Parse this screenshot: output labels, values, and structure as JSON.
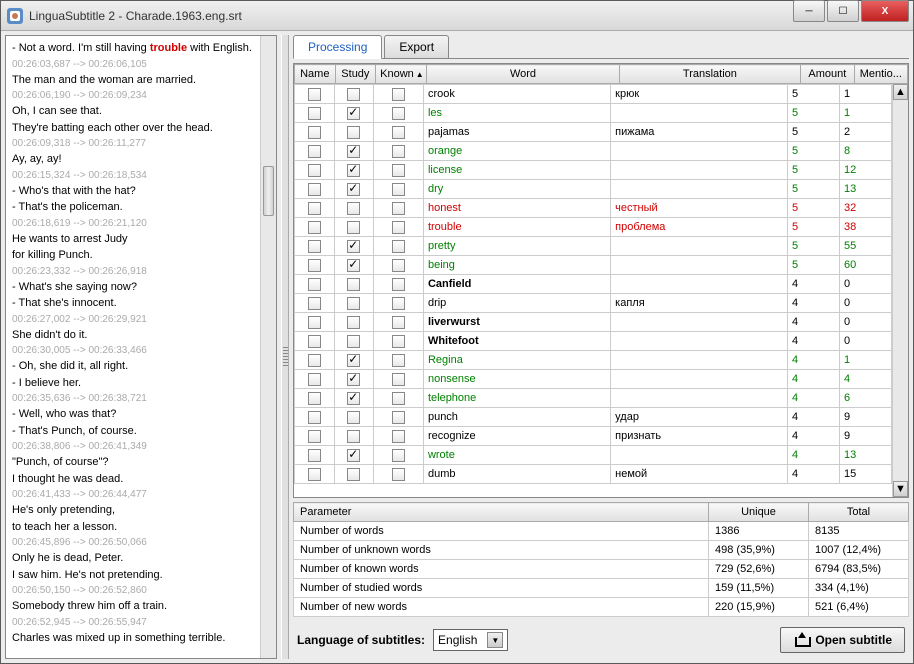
{
  "window": {
    "title": "LinguaSubtitle 2 - Charade.1963.eng.srt"
  },
  "subtitles": [
    {
      "text": "- Not a word. I'm still having ",
      "hl": "trouble",
      "tail": " with English.",
      "time": "00:26:03,687 --> 00:26:06,105"
    },
    {
      "text": "The man and the woman are married.",
      "time": "00:26:06,190 --> 00:26:09,234"
    },
    {
      "text": "Oh, I can see that.\nThey're batting each other over the head.",
      "time": "00:26:09,318 --> 00:26:11,277"
    },
    {
      "text": "Ay, ay, ay!",
      "time": "00:26:15,324 --> 00:26:18,534"
    },
    {
      "text": "- Who's that with the hat?\n- That's the policeman.",
      "time": "00:26:18,619 --> 00:26:21,120"
    },
    {
      "text": "He wants to arrest Judy\nfor killing Punch.",
      "time": "00:26:23,332 --> 00:26:26,918"
    },
    {
      "text": "- What's she saying now?\n- That she's innocent.",
      "time": "00:26:27,002 --> 00:26:29,921"
    },
    {
      "text": "She didn't do it.",
      "time": "00:26:30,005 --> 00:26:33,466"
    },
    {
      "text": "- Oh, she did it, all right.\n- I believe her.",
      "time": "00:26:35,636 --> 00:26:38,721"
    },
    {
      "text": "- Well, who was that?\n- That's Punch, of course.",
      "time": "00:26:38,806 --> 00:26:41,349"
    },
    {
      "text": "\"Punch, of course\"?\nI thought he was dead.",
      "time": "00:26:41,433 --> 00:26:44,477"
    },
    {
      "text": "He's only pretending,\nto teach her a lesson.",
      "time": "00:26:45,896 --> 00:26:50,066"
    },
    {
      "text": "Only he is dead, Peter.\nI saw him. He's not pretending.",
      "time": "00:26:50,150 --> 00:26:52,860"
    },
    {
      "text": "Somebody threw him off a train.",
      "time": "00:26:52,945 --> 00:26:55,947"
    },
    {
      "text": "Charles was mixed up in something terrible.",
      "time": ""
    }
  ],
  "tabs": {
    "processing": "Processing",
    "export": "Export"
  },
  "columns": {
    "name": "Name",
    "study": "Study",
    "known": "Known",
    "word": "Word",
    "translation": "Translation",
    "amount": "Amount",
    "mention": "Mentio..."
  },
  "rows": [
    {
      "study": false,
      "word": "crook",
      "cls": "",
      "trans": "крюк",
      "amount": "5",
      "mention": "1"
    },
    {
      "study": true,
      "word": "les",
      "cls": "g",
      "trans": "",
      "amount": "5",
      "mention": "1",
      "ncls": "g"
    },
    {
      "study": false,
      "word": "pajamas",
      "cls": "",
      "trans": "пижама",
      "amount": "5",
      "mention": "2"
    },
    {
      "study": true,
      "word": "orange",
      "cls": "g",
      "trans": "",
      "amount": "5",
      "mention": "8",
      "ncls": "g"
    },
    {
      "study": true,
      "word": "license",
      "cls": "g",
      "trans": "",
      "amount": "5",
      "mention": "12",
      "ncls": "g"
    },
    {
      "study": true,
      "word": "dry",
      "cls": "g",
      "trans": "",
      "amount": "5",
      "mention": "13",
      "ncls": "g"
    },
    {
      "study": false,
      "word": "honest",
      "cls": "r",
      "trans": "честный",
      "amount": "5",
      "mention": "32",
      "ncls": "r"
    },
    {
      "study": false,
      "word": "trouble",
      "cls": "r",
      "trans": "проблема",
      "amount": "5",
      "mention": "38",
      "ncls": "r"
    },
    {
      "study": true,
      "word": "pretty",
      "cls": "g",
      "trans": "",
      "amount": "5",
      "mention": "55",
      "ncls": "g"
    },
    {
      "study": true,
      "word": "being",
      "cls": "g",
      "trans": "",
      "amount": "5",
      "mention": "60",
      "ncls": "g"
    },
    {
      "study": false,
      "word": "Canfield",
      "cls": "b",
      "trans": "",
      "amount": "4",
      "mention": "0"
    },
    {
      "study": false,
      "word": "drip",
      "cls": "",
      "trans": "капля",
      "amount": "4",
      "mention": "0"
    },
    {
      "study": false,
      "word": "liverwurst",
      "cls": "b",
      "trans": "",
      "amount": "4",
      "mention": "0"
    },
    {
      "study": false,
      "word": "Whitefoot",
      "cls": "b",
      "trans": "",
      "amount": "4",
      "mention": "0"
    },
    {
      "study": true,
      "word": "Regina",
      "cls": "g",
      "trans": "",
      "amount": "4",
      "mention": "1",
      "ncls": "g"
    },
    {
      "study": true,
      "word": "nonsense",
      "cls": "g",
      "trans": "",
      "amount": "4",
      "mention": "4",
      "ncls": "g"
    },
    {
      "study": true,
      "word": "telephone",
      "cls": "g",
      "trans": "",
      "amount": "4",
      "mention": "6",
      "ncls": "g"
    },
    {
      "study": false,
      "word": "punch",
      "cls": "",
      "trans": "удар",
      "amount": "4",
      "mention": "9"
    },
    {
      "study": false,
      "word": "recognize",
      "cls": "",
      "trans": "признать",
      "amount": "4",
      "mention": "9"
    },
    {
      "study": true,
      "word": "wrote",
      "cls": "g",
      "trans": "",
      "amount": "4",
      "mention": "13",
      "ncls": "g"
    },
    {
      "study": false,
      "word": "dumb",
      "cls": "",
      "trans": "немой",
      "amount": "4",
      "mention": "15"
    }
  ],
  "stats": {
    "headers": {
      "param": "Parameter",
      "unique": "Unique",
      "total": "Total"
    },
    "rows": [
      {
        "param": "Number of words",
        "unique": "1386",
        "total": "8135"
      },
      {
        "param": "Number of unknown words",
        "unique": "498 (35,9%)",
        "total": "1007 (12,4%)"
      },
      {
        "param": "Number of known words",
        "unique": "729 (52,6%)",
        "total": "6794 (83,5%)"
      },
      {
        "param": "Number of studied words",
        "unique": "159 (11,5%)",
        "total": "334 (4,1%)"
      },
      {
        "param": "Number of new words",
        "unique": "220 (15,9%)",
        "total": "521 (6,4%)"
      }
    ]
  },
  "bottom": {
    "lang_label": "Language of subtitles:",
    "lang_value": "English",
    "open_btn": "Open subtitle"
  }
}
